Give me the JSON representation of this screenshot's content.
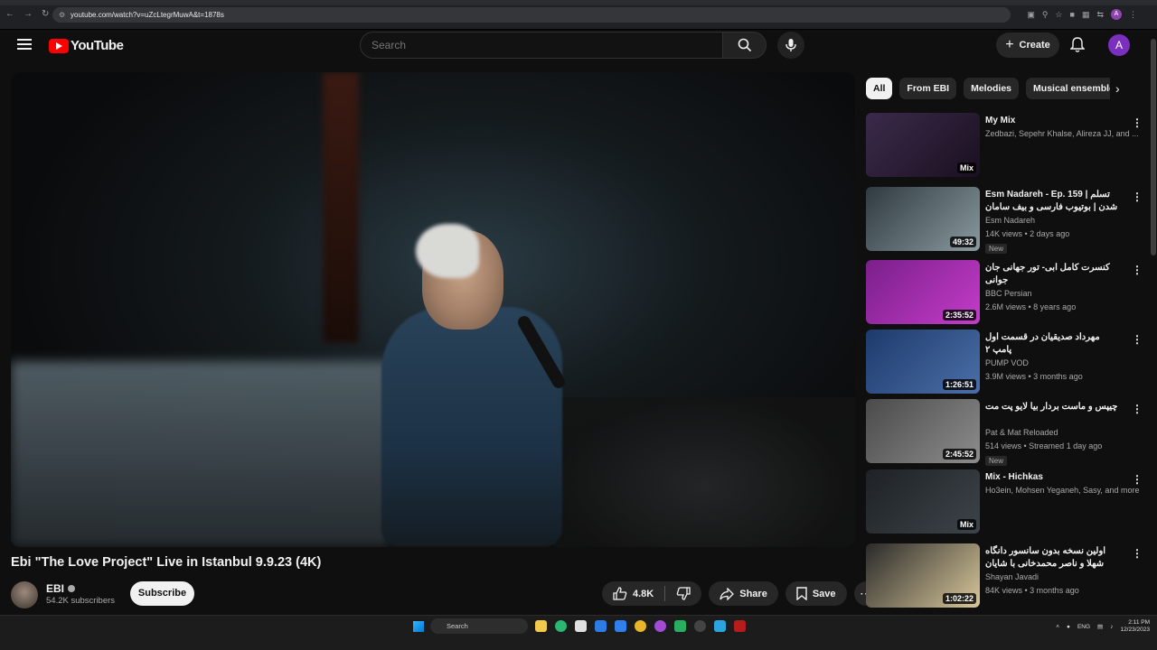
{
  "browser": {
    "url": "youtube.com/watch?v=uZcLtegrMuwA&t=1878s"
  },
  "header": {
    "logo_text": "YouTube",
    "search_placeholder": "Search",
    "create_label": "Create",
    "avatar_letter": "A"
  },
  "video": {
    "title": "Ebi \"The Love Project\" Live in Istanbul 9.9.23 (4K)",
    "channel": "EBI",
    "subscribers": "54.2K subscribers",
    "subscribe_label": "Subscribe",
    "likes": "4.8K",
    "share_label": "Share",
    "save_label": "Save"
  },
  "chips": [
    "All",
    "From EBI",
    "Melodies",
    "Musical ensemble"
  ],
  "recommendations": [
    {
      "title": "My Mix",
      "channel": "Zedbazi, Sepehr Khalse, Alireza JJ, and ...",
      "meta": "",
      "badge": "",
      "duration": "Mix",
      "colors": [
        "#3b2a4a",
        "#1a1020"
      ]
    },
    {
      "title": "Esm Nadareh - Ep. 159 | تسلم شدن | بوتیوب فارسی و بیف سامان ویلسون و ...",
      "channel": "Esm Nadareh",
      "meta": "14K views • 2 days ago",
      "badge": "New",
      "duration": "49:32",
      "colors": [
        "#2f3a3f",
        "#8a9aa0"
      ]
    },
    {
      "title": "کنسرت کامل ابی- تور جهانی جان جوانی",
      "channel": "BBC Persian",
      "meta": "2.6M views • 8 years ago",
      "badge": "",
      "duration": "2:35:52",
      "colors": [
        "#7a1f8a",
        "#c43cc9"
      ]
    },
    {
      "title": "مهرداد صدیقیان در قسمت اول پامپ ۲",
      "channel": "PUMP VOD",
      "meta": "3.9M views • 3 months ago",
      "badge": "",
      "duration": "1:26:51",
      "colors": [
        "#1e3a6b",
        "#4a6fa8"
      ]
    },
    {
      "title": "چیپس و ماست بردار بیا لایو پت مت",
      "channel": "Pat & Mat Reloaded",
      "meta": "514 views • Streamed 1 day ago",
      "badge": "New",
      "duration": "2:45:52",
      "colors": [
        "#4a4a4a",
        "#8d8d8d"
      ]
    },
    {
      "title": "Mix - Hichkas",
      "channel": "Ho3ein, Mohsen Yeganeh, Sasy, and more",
      "meta": "",
      "badge": "",
      "duration": "Mix",
      "colors": [
        "#1e2226",
        "#3d4449"
      ]
    },
    {
      "title": "اولین نسخه بدون سانسور دانگاه شهلا و ناصر محمدخانی با شایان #مستند #جنایی ...",
      "channel": "Shayan Javadi",
      "meta": "84K views • 3 months ago",
      "badge": "",
      "duration": "1:02:22",
      "colors": [
        "#2a2a2a",
        "#d8c79a"
      ]
    }
  ],
  "taskbar": {
    "search_label": "Search",
    "lang": "ENG",
    "time": "2:11 PM",
    "date": "12/23/2023"
  }
}
